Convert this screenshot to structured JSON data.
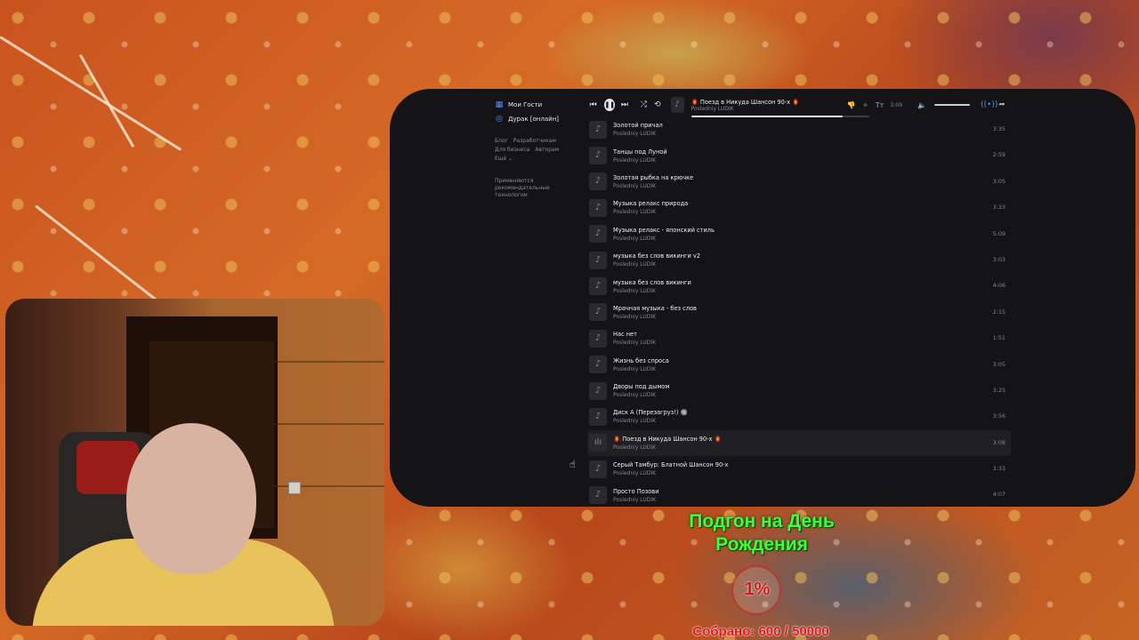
{
  "sidebar": {
    "items": [
      {
        "label": "Мои Гости",
        "icon": "grid-icon"
      },
      {
        "label": "Дурак [онлайн]",
        "icon": "gamepad-icon"
      }
    ],
    "footer_links": [
      "Блог",
      "Разработчикам",
      "Для бизнеса",
      "Авторам",
      "Ещё ⌄"
    ],
    "note": "Применяются рекомендательные технологии"
  },
  "player": {
    "now_playing_title": "🏮 Поезд в Никуда Шансон 90-х 🏮",
    "now_playing_artist": "Posledniy LUDIK",
    "time": "3:09",
    "progress_fraction": 0.85,
    "state": "playing"
  },
  "tracks": [
    {
      "title": "Золотой причал",
      "artist": "Posledniy LUDIK",
      "duration": "3:35"
    },
    {
      "title": "Танцы под Луной",
      "artist": "Posledniy LUDIK",
      "duration": "2:59"
    },
    {
      "title": "Золотая рыбка на крючке",
      "artist": "Posledniy LUDIK",
      "duration": "3:05"
    },
    {
      "title": "Музыка релакс природа",
      "artist": "Posledniy LUDIK",
      "duration": "3:33"
    },
    {
      "title": "Музыка релакс - японский стиль",
      "artist": "Posledniy LUDIK",
      "duration": "5:09"
    },
    {
      "title": "музыка без слов викинги v2",
      "artist": "Posledniy LUDIK",
      "duration": "3:03"
    },
    {
      "title": "музыка без слов викинги",
      "artist": "Posledniy LUDIK",
      "duration": "4:06"
    },
    {
      "title": "Мрачная музыка - без слов",
      "artist": "Posledniy LUDIK",
      "duration": "2:15"
    },
    {
      "title": "Нас нет",
      "artist": "Posledniy LUDIK",
      "duration": "1:51"
    },
    {
      "title": "Жизнь без спроса",
      "artist": "Posledniy LUDIK",
      "duration": "3:05"
    },
    {
      "title": "Дворы под дымом",
      "artist": "Posledniy LUDIK",
      "duration": "3:25"
    },
    {
      "title": "Диск А (Перезагруз!) 🔘",
      "artist": "Posledniy LUDIK",
      "duration": "3:56"
    },
    {
      "title": "🏮 Поезд в Никуда Шансон 90-х 🏮",
      "artist": "Posledniy LUDIK",
      "duration": "3:08",
      "active": true
    },
    {
      "title": "Серый Тамбур: Блатной Шансон 90-х",
      "artist": "Posledniy LUDIK",
      "duration": "3:33"
    },
    {
      "title": "Просто Позови",
      "artist": "Posledniy LUDIK",
      "duration": "4:07"
    }
  ],
  "donation": {
    "title_line1": "Подгон на День",
    "title_line2": "Рождения",
    "percent": "1%",
    "collected_text": "Собрано: 600 / 50000",
    "collected": 600,
    "goal": 50000,
    "title_color": "#3cff3c",
    "accent_color": "#e01a1a"
  },
  "colors": {
    "app_bg": "#141416",
    "accent": "#5a8df0"
  }
}
